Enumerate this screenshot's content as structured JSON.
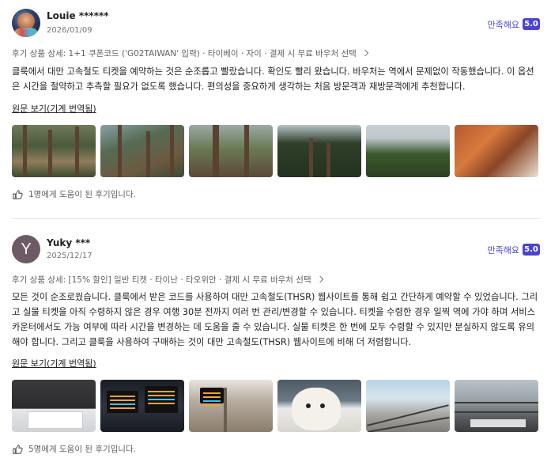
{
  "reviews": [
    {
      "user": "Louie ******",
      "date": "2026/01/09",
      "satisfaction_label": "만족해요",
      "score": "5.0",
      "detail": "후기 상품 상세: 1+1 쿠폰코드 ('G02TAIWAN' 입력) · 타이베이 · 자이 · 결제 시 무료 바우처 선택",
      "body": "클룩에서 대만 고속철도 티켓을 예약하는 것은 순조롭고 빨랐습니다. 확인도 빨리 왔습니다. 바우처는 역에서 문제없이 작동했습니다. 이 옵션은 시간을 절약하고 추측할 필요가 없도록 했습니다. 편의성을 중요하게 생각하는 처음 방문객과 재방문객에게 추천합니다.",
      "original_link": "원문 보기(기계 번역됨)",
      "helpful": "1명에게 도움이 된 후기입니다.",
      "photos": [
        "forest-photo",
        "forest-photo",
        "forest-photo",
        "forest-photo",
        "forest-photo",
        "wooden-bridge-photo"
      ]
    },
    {
      "user": "Yuky ***",
      "avatar_letter": "Y",
      "date": "2025/12/17",
      "satisfaction_label": "만족해요",
      "score": "5.0",
      "detail": "후기 상품 상세: [15% 할인] 일반 티켓 · 타이난 · 타오위안 · 결제 시 무료 바우처 선택",
      "body": "모든 것이 순조로웠습니다. 클룩에서 받은 코드를 사용하여 대만 고속철도(THSR) 웹사이트를 통해 쉽고 간단하게 예약할 수 있었습니다. 그리고 실물 티켓을 아직 수령하지 않은 경우 여행 30분 전까지 여러 번 관리/변경할 수 있습니다. 티켓을 수령한 경우 일찍 역에 가야 하며 서비스 카운터에서도 가능 여부에 따라 시간을 변경하는 데 도움을 줄 수 있습니다. 실물 티켓은 한 번에 모두 수령할 수 있지만 분실하지 않도록 유의해야 합니다. 그리고 클룩을 사용하여 구매하는 것이 대만 고속철도(THSR) 웹사이트에 비해 더 저렴합니다.",
      "original_link": "원문 보기(기계 번역됨)",
      "helpful": "5명에게 도움이 된 후기입니다.",
      "photos": [
        "ticket-photo",
        "departure-board-photo",
        "station-hall-photo",
        "plush-bear-photo",
        "platform-photo",
        "train-tracks-photo"
      ]
    }
  ],
  "colors": {
    "accent": "#4b44d1",
    "text": "#212121",
    "muted": "#616161"
  }
}
